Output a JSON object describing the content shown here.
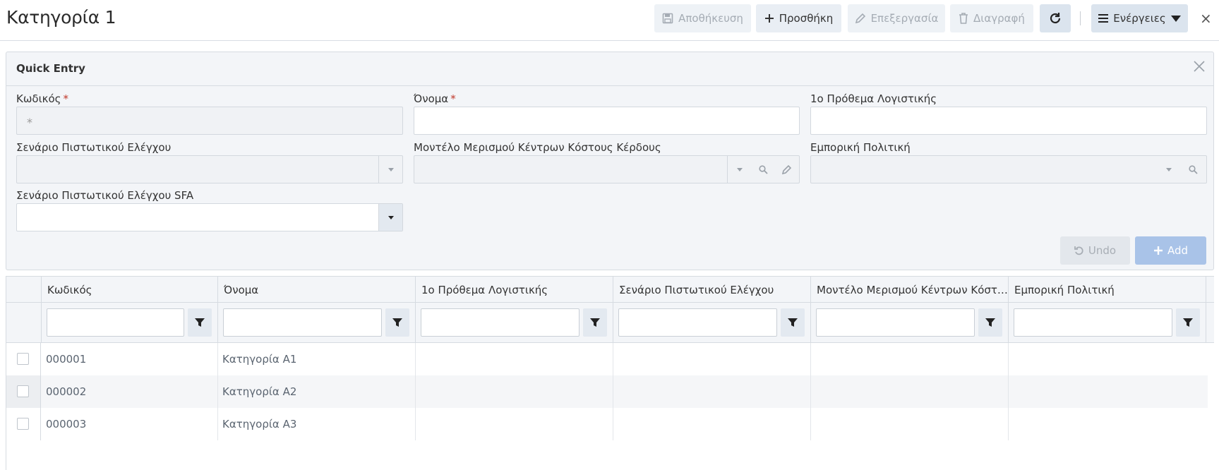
{
  "header": {
    "title": "Κατηγορία 1",
    "buttons": {
      "save": "Αποθήκευση",
      "add": "Προσθήκη",
      "edit": "Επεξεργασία",
      "delete": "Διαγραφή",
      "actions": "Ενέργειες"
    },
    "close": "×"
  },
  "quick_entry": {
    "title": "Quick Entry",
    "required_marker": "*",
    "fields": {
      "code": {
        "label": "Κωδικός",
        "placeholder": "*"
      },
      "name": {
        "label": "Όνομα"
      },
      "prefix": {
        "label": "1ο Πρόθεμα Λογιστικής"
      },
      "credit_scenario": {
        "label": "Σενάριο Πιστωτικού Ελέγχου"
      },
      "cost_model": {
        "label": "Μοντέλο Μερισμού Κέντρων Κόστους Κέρδους"
      },
      "commercial_policy": {
        "label": "Εμπορική Πολιτική"
      },
      "credit_scenario_sfa": {
        "label": "Σενάριο Πιστωτικού Ελέγχου SFA"
      }
    },
    "undo": "Undo",
    "add": "Add"
  },
  "grid": {
    "columns": [
      "Κωδικός",
      "Όνομα",
      "1ο Πρόθεμα Λογιστικής",
      "Σενάριο Πιστωτικού Ελέγχου",
      "Μοντέλο Μερισμού Κέντρων Κόστο...",
      "Εμπορική Πολιτική"
    ],
    "rows": [
      {
        "code": "000001",
        "name": "Κατηγορία Α1"
      },
      {
        "code": "000002",
        "name": "Κατηγορία Α2"
      },
      {
        "code": "000003",
        "name": "Κατηγορία Α3"
      }
    ]
  }
}
